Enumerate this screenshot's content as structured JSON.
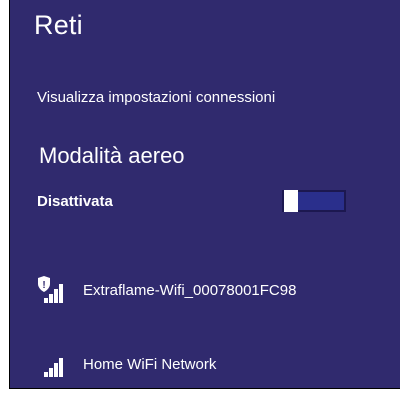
{
  "panel": {
    "title": "Reti",
    "settings_link": "Visualizza impostazioni connessioni"
  },
  "airplane_mode": {
    "heading": "Modalità aereo",
    "status": "Disattivata",
    "enabled": false
  },
  "networks": [
    {
      "name": "Extraflame-Wifi_00078001FC98",
      "secured": true,
      "signal_bars": 4,
      "icon": "wifi-secured-icon"
    },
    {
      "name": "Home WiFi Network",
      "secured": false,
      "signal_bars": 4,
      "icon": "wifi-signal-icon"
    }
  ],
  "colors": {
    "panel_background": "#302a6e",
    "text": "#ffffff",
    "toggle_track": "#23206a"
  }
}
